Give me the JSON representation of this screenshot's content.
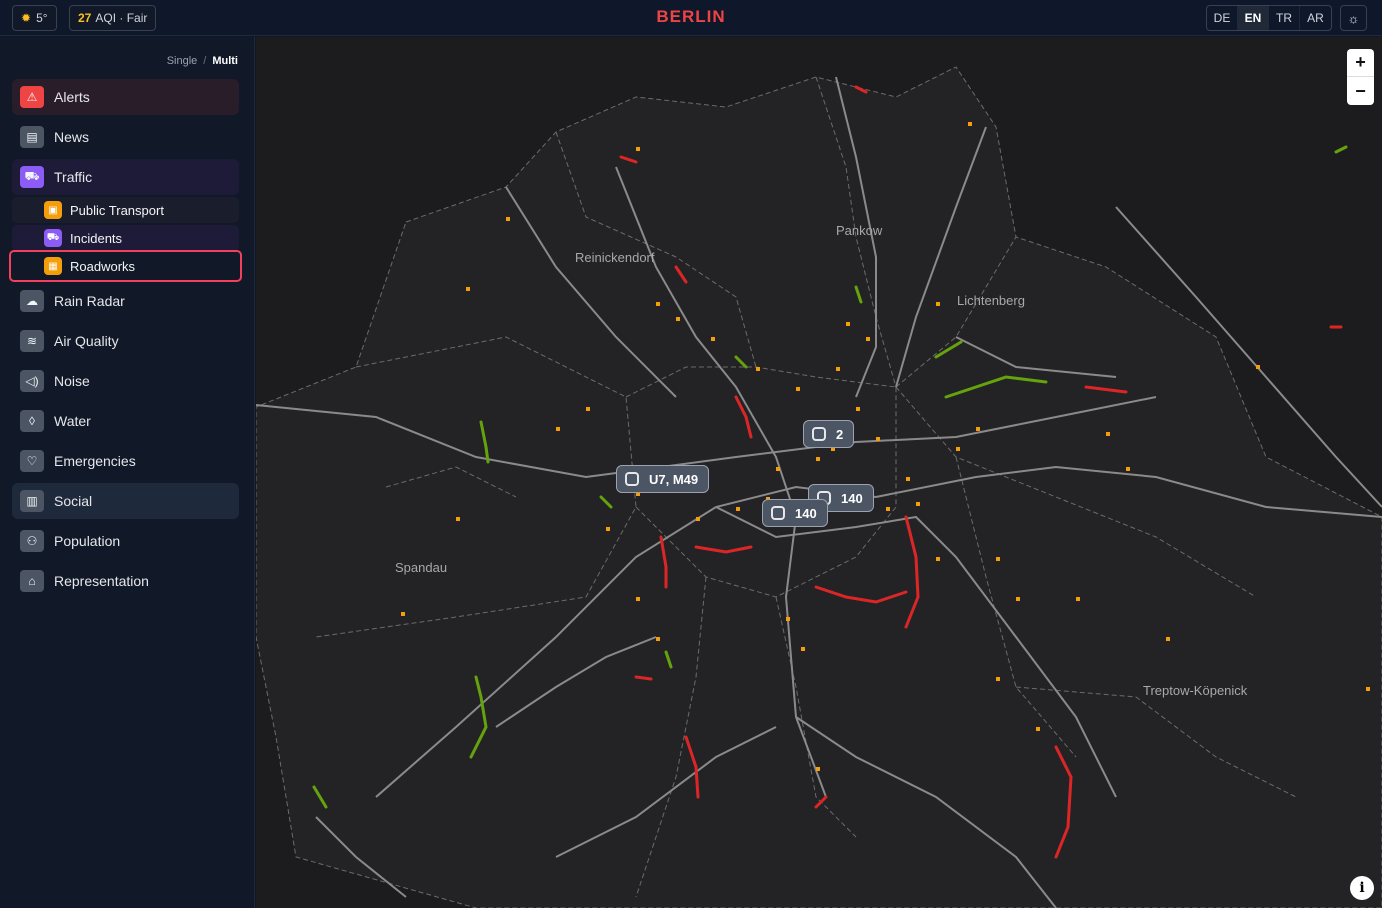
{
  "header": {
    "weather": "5°",
    "aqi_value": "27",
    "aqi_label": "AQI · Fair",
    "city": "BERLIN",
    "city_color": "#ef4444",
    "languages": [
      "DE",
      "EN",
      "TR",
      "AR"
    ],
    "active_language": "EN"
  },
  "sidebar": {
    "mode_single": "Single",
    "mode_separator": "/",
    "mode_multi": "Multi",
    "items": [
      {
        "label": "Alerts",
        "icon": "alert-triangle-icon"
      },
      {
        "label": "News",
        "icon": "newspaper-icon"
      },
      {
        "label": "Traffic",
        "icon": "car-icon"
      },
      {
        "label": "Rain Radar",
        "icon": "cloud-rain-icon"
      },
      {
        "label": "Air Quality",
        "icon": "wind-icon"
      },
      {
        "label": "Noise",
        "icon": "speaker-icon"
      },
      {
        "label": "Water",
        "icon": "droplet-icon"
      },
      {
        "label": "Emergencies",
        "icon": "heart-pulse-icon"
      },
      {
        "label": "Social",
        "icon": "bar-chart-icon"
      },
      {
        "label": "Population",
        "icon": "users-icon"
      },
      {
        "label": "Representation",
        "icon": "landmark-icon"
      }
    ],
    "traffic_sub": [
      {
        "label": "Public Transport",
        "icon": "tram-icon"
      },
      {
        "label": "Incidents",
        "icon": "car-icon"
      },
      {
        "label": "Roadworks",
        "icon": "barrier-icon"
      }
    ]
  },
  "map": {
    "districts": [
      "Pankow",
      "Reinickendorf",
      "Lichtenberg",
      "Spandau",
      "Treptow-Köpenick"
    ],
    "transit_labels": [
      "2",
      "U7, M49",
      "140",
      "140"
    ],
    "zoom_in": "+",
    "zoom_out": "−",
    "info": "i",
    "colors": {
      "heavy": "#dc2626",
      "free": "#65a30d",
      "roadworks": "#f59e0b"
    }
  }
}
